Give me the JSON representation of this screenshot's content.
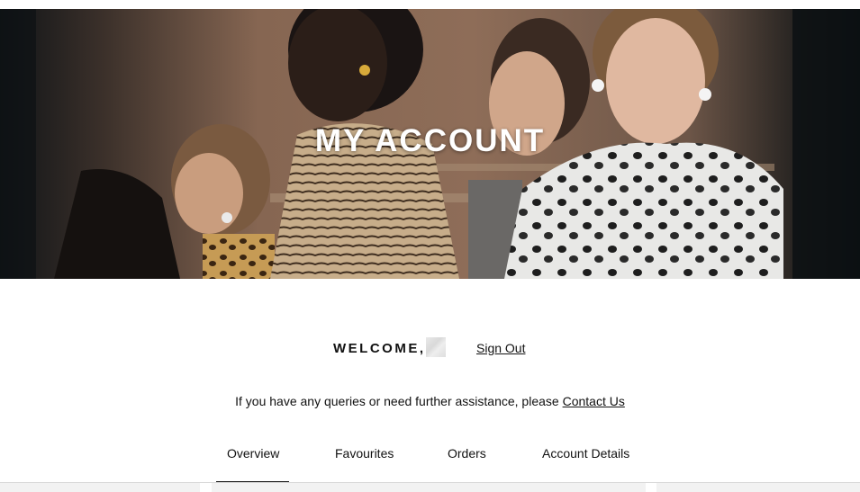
{
  "hero": {
    "title": "MY ACCOUNT"
  },
  "account": {
    "welcome_label": "WELCOME,",
    "sign_out_label": "Sign Out"
  },
  "help": {
    "text": "If you have any queries or need further assistance, please ",
    "contact_link": "Contact Us"
  },
  "tabs": [
    {
      "label": "Overview",
      "active": true
    },
    {
      "label": "Favourites",
      "active": false
    },
    {
      "label": "Orders",
      "active": false
    },
    {
      "label": "Account Details",
      "active": false
    }
  ]
}
